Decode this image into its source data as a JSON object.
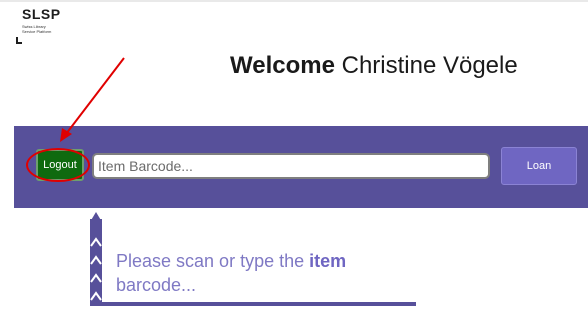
{
  "logo": {
    "title": "SLSP",
    "line1": "Swiss Library",
    "line2": "Service Platform"
  },
  "welcome": {
    "prefix": "Welcome",
    "name": "Christine Vögele"
  },
  "toolbar": {
    "logout_label": "Logout",
    "barcode_placeholder": "Item Barcode...",
    "barcode_value": "",
    "loan_label": "Loan"
  },
  "hint": {
    "text_before": "Please scan or type the ",
    "text_bold": "item",
    "text_after": "barcode..."
  },
  "colors": {
    "band": "#57509a",
    "logout": "#0f6a0f",
    "loan": "#6f66c2",
    "annotation": "#e00000",
    "hint_text": "#7f79c4"
  }
}
